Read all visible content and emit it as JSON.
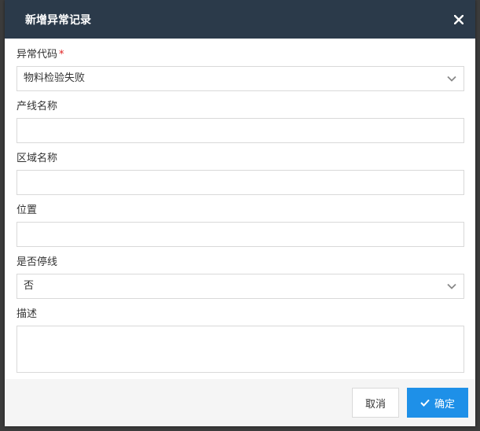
{
  "dialog": {
    "title": "新增异常记录",
    "close_icon": "close-icon"
  },
  "form": {
    "exception_code": {
      "label": "异常代码",
      "required_mark": "*",
      "value": "物料检验失败"
    },
    "line_name": {
      "label": "产线名称",
      "value": ""
    },
    "area_name": {
      "label": "区域名称",
      "value": ""
    },
    "position": {
      "label": "位置",
      "value": ""
    },
    "line_stopped": {
      "label": "是否停线",
      "value": "否"
    },
    "description": {
      "label": "描述",
      "value": ""
    }
  },
  "footer": {
    "cancel_label": "取消",
    "confirm_label": "确定",
    "confirm_icon": "check-icon"
  },
  "colors": {
    "header_bg": "#2b3a4a",
    "primary": "#1e90e8",
    "required": "#e02020"
  }
}
